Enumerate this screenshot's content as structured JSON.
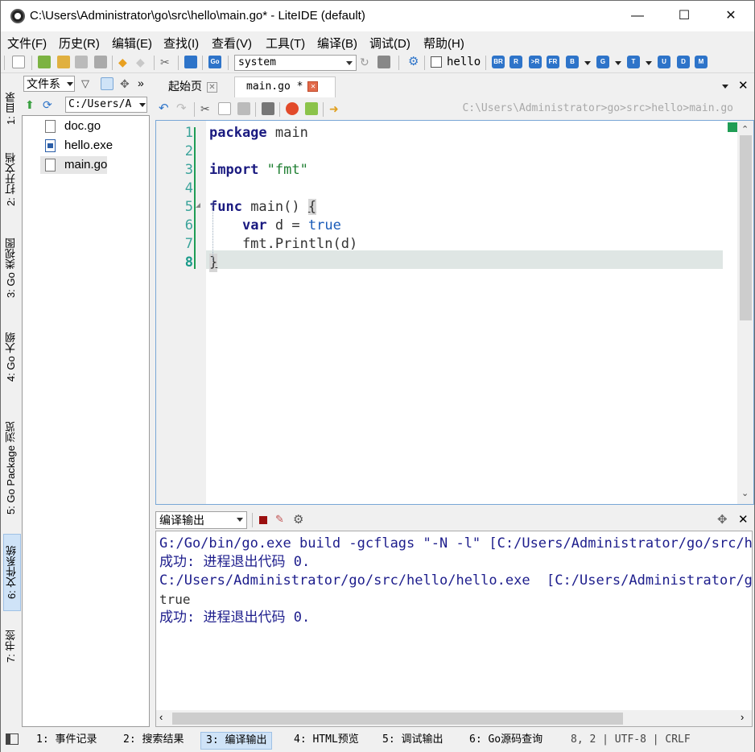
{
  "window": {
    "title": "C:\\Users\\Administrator\\go\\src\\hello\\main.go* - LiteIDE (default)",
    "minimize": "—",
    "maximize": "☐",
    "close": "✕"
  },
  "menu": [
    "文件(F)",
    "历史(R)",
    "编辑(E)",
    "查找(I)",
    "查看(V)",
    "工具(T)",
    "编译(B)",
    "调试(D)",
    "帮助(H)"
  ],
  "toolbar": {
    "env_select": "system",
    "hello_checkbox_label": "hello",
    "build_buttons": [
      "BR",
      "R",
      ">R",
      "FR",
      "B",
      "G",
      "T",
      "U",
      "D",
      "M"
    ],
    "accent_color": "#2e74c9"
  },
  "left_tabs": [
    "1: 目录",
    "2: 打开文档",
    "3: Go 类视图",
    "4: Go 大纲",
    "5: Go Package 浏览",
    "6: 文件系统",
    "7: 书签"
  ],
  "file_panel": {
    "view_select": "文件系",
    "path_select": "C:/Users/A",
    "files": [
      "doc.go",
      "hello.exe",
      "main.go"
    ]
  },
  "editor": {
    "tabs": [
      "起始页",
      "main.go *"
    ],
    "breadcrumb": "C:\\Users\\Administrator>go>src>hello>main.go",
    "line_numbers": [
      "1",
      "2",
      "3",
      "4",
      "5",
      "6",
      "7",
      "8"
    ],
    "code": {
      "l1_kw": "package",
      "l1_rest": " main",
      "l3_kw": "import",
      "l3_str": "\"fmt\"",
      "l5_kw": "func",
      "l5_rest": " main() ",
      "l5_brace": "{",
      "l6_indent": "    ",
      "l6_kw": "var",
      "l6_rest": " d = ",
      "l6_bool": "true",
      "l7": "    fmt.Println(d)",
      "l8": "}"
    }
  },
  "output": {
    "select": "编译输出",
    "lines": [
      "G:/Go/bin/go.exe build -gcflags \"-N -l\" [C:/Users/Administrator/go/src/hello]",
      "成功: 进程退出代码 0.",
      "C:/Users/Administrator/go/src/hello/hello.exe  [C:/Users/Administrator/go/src/hello]",
      "true",
      "成功: 进程退出代码 0."
    ]
  },
  "status": {
    "tabs": [
      "1: 事件记录",
      "2: 搜索结果",
      "3: 编译输出",
      "4: HTML预览",
      "5: 调试输出",
      "6: Go源码查询"
    ],
    "position": "8, 2 | UTF-8 | CRLF"
  }
}
